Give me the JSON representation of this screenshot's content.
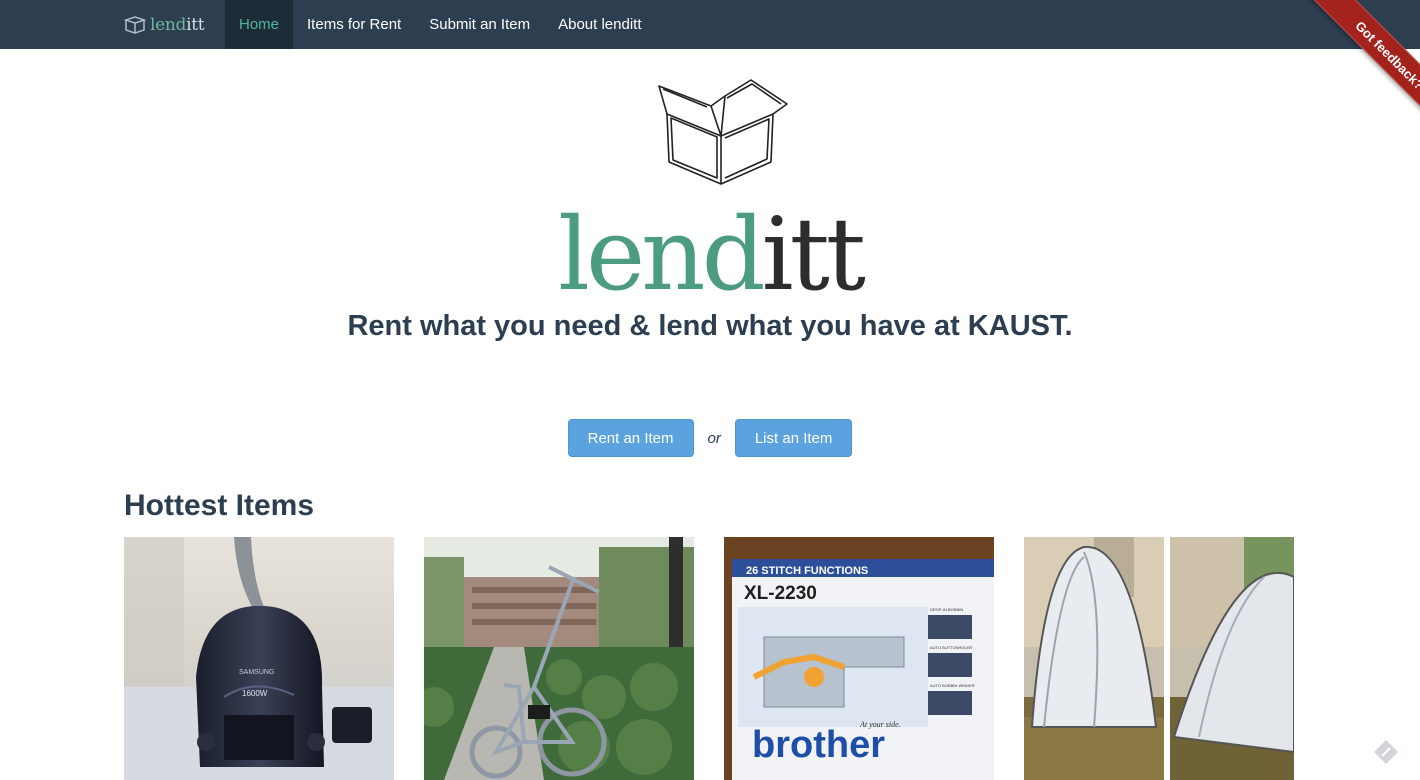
{
  "app": {
    "brand_lend": "lend",
    "brand_itt": "itt"
  },
  "nav": {
    "items": [
      {
        "label": "Home",
        "active": true
      },
      {
        "label": "Items for Rent",
        "active": false
      },
      {
        "label": "Submit an Item",
        "active": false
      },
      {
        "label": "About lenditt",
        "active": false
      }
    ]
  },
  "ribbon": {
    "label": "Got feedback?"
  },
  "hero": {
    "wordmark_lend": "lend",
    "wordmark_itt": "itt",
    "tagline": "Rent what you need & lend what you have at KAUST.",
    "rent_button": "Rent an Item",
    "or_text": "or",
    "list_button": "List an Item"
  },
  "hottest": {
    "title": "Hottest Items",
    "items": [
      {
        "name": "vacuum-cleaner",
        "photo_text": [
          "SAMSUNG",
          "1600W"
        ]
      },
      {
        "name": "folding-bicycle",
        "photo_text": []
      },
      {
        "name": "sewing-machine",
        "photo_text": [
          "26 STITCH FUNCTIONS",
          "XL-2230",
          "brother",
          "At your side.",
          "DROP-IN BOBBIN",
          "AUTO BUTTONHOLER",
          "AUTO BOBBIN WINDER"
        ]
      },
      {
        "name": "camping-tent",
        "photo_text": []
      }
    ]
  },
  "colors": {
    "navbar": "#2c3e50",
    "accent_green": "#4cb89a",
    "button_blue": "#5aa3df",
    "ribbon_red": "#a4221c"
  }
}
